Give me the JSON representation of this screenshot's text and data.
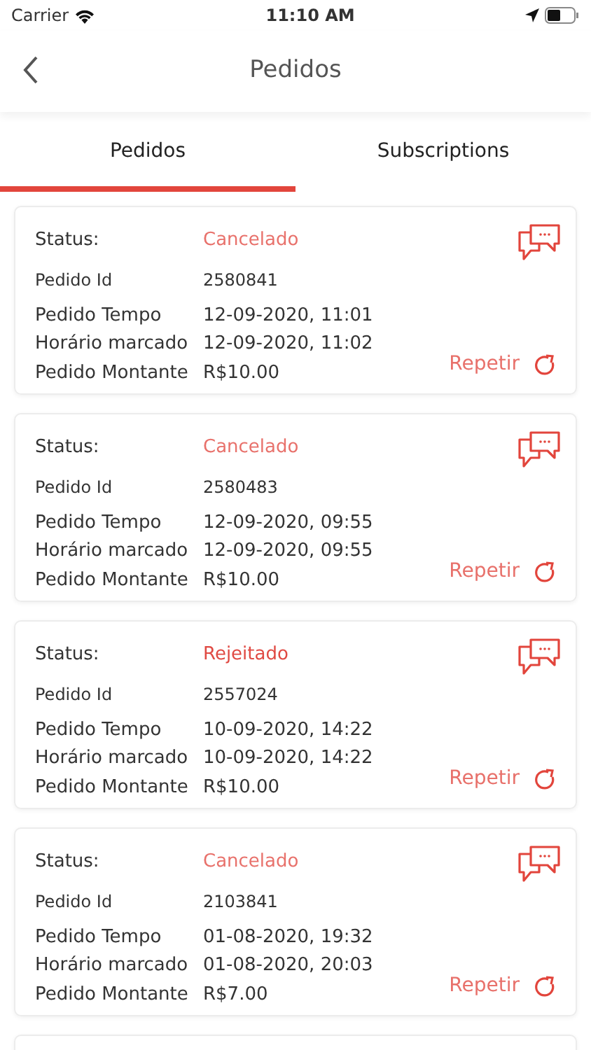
{
  "status_bar": {
    "carrier": "Carrier",
    "time": "11:10 AM"
  },
  "header": {
    "title": "Pedidos"
  },
  "tabs": [
    {
      "label": "Pedidos",
      "selected": true
    },
    {
      "label": "Subscriptions",
      "selected": false
    }
  ],
  "orders": [
    {
      "status_label": "Status:",
      "status": "Cancelado",
      "color": "#e8716b",
      "fields": [
        {
          "label": "Pedido Id",
          "value": "2580841"
        },
        {
          "label": "Pedido Tempo",
          "value": "12-09-2020, 11:01"
        },
        {
          "label": "Horário marcado",
          "value": "12-09-2020, 11:02"
        },
        {
          "label": "Pedido Montante",
          "value": "R$10.00"
        }
      ],
      "action": "Repetir"
    },
    {
      "status_label": "Status:",
      "status": "Cancelado",
      "color": "#e8716b",
      "fields": [
        {
          "label": "Pedido Id",
          "value": "2580483"
        },
        {
          "label": "Pedido Tempo",
          "value": "12-09-2020, 09:55"
        },
        {
          "label": "Horário marcado",
          "value": "12-09-2020, 09:55"
        },
        {
          "label": "Pedido Montante",
          "value": "R$10.00"
        }
      ],
      "action": "Repetir"
    },
    {
      "status_label": "Status:",
      "status": "Rejeitado",
      "color": "#e04a43",
      "fields": [
        {
          "label": "Pedido Id",
          "value": "2557024"
        },
        {
          "label": "Pedido Tempo",
          "value": "10-09-2020, 14:22"
        },
        {
          "label": "Horário marcado",
          "value": "10-09-2020, 14:22"
        },
        {
          "label": "Pedido Montante",
          "value": "R$10.00"
        }
      ],
      "action": "Repetir"
    },
    {
      "status_label": "Status:",
      "status": "Cancelado",
      "color": "#e8716b",
      "fields": [
        {
          "label": "Pedido Id",
          "value": "2103841"
        },
        {
          "label": "Pedido Tempo",
          "value": "01-08-2020, 19:32"
        },
        {
          "label": "Horário marcado",
          "value": "01-08-2020, 20:03"
        },
        {
          "label": "Pedido Montante",
          "value": "R$7.00"
        }
      ],
      "action": "Repetir"
    }
  ]
}
